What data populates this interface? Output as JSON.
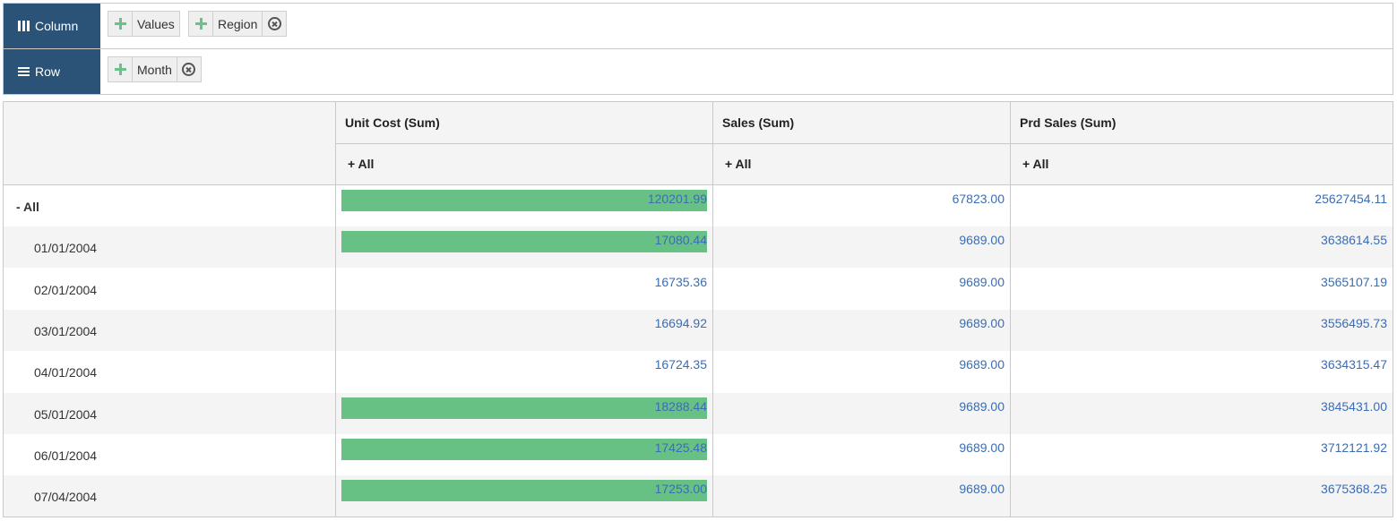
{
  "zones": {
    "column": {
      "label": "Column",
      "pills": [
        {
          "label": "Values",
          "removable": false
        },
        {
          "label": "Region",
          "removable": true
        }
      ]
    },
    "row": {
      "label": "Row",
      "pills": [
        {
          "label": "Month",
          "removable": true
        }
      ]
    }
  },
  "grid": {
    "columns": [
      {
        "header": "Unit Cost (Sum)",
        "sub": "+ All"
      },
      {
        "header": "Sales (Sum)",
        "sub": "+ All"
      },
      {
        "header": "Prd Sales (Sum)",
        "sub": "+ All"
      }
    ],
    "rows": [
      {
        "label": "- All",
        "bold": true,
        "values": [
          "120201.99",
          "67823.00",
          "25627454.11"
        ],
        "highlight": true
      },
      {
        "label": "01/01/2004",
        "bold": false,
        "values": [
          "17080.44",
          "9689.00",
          "3638614.55"
        ],
        "highlight": true
      },
      {
        "label": "02/01/2004",
        "bold": false,
        "values": [
          "16735.36",
          "9689.00",
          "3565107.19"
        ],
        "highlight": false
      },
      {
        "label": "03/01/2004",
        "bold": false,
        "values": [
          "16694.92",
          "9689.00",
          "3556495.73"
        ],
        "highlight": false
      },
      {
        "label": "04/01/2004",
        "bold": false,
        "values": [
          "16724.35",
          "9689.00",
          "3634315.47"
        ],
        "highlight": false
      },
      {
        "label": "05/01/2004",
        "bold": false,
        "values": [
          "18288.44",
          "9689.00",
          "3845431.00"
        ],
        "highlight": true
      },
      {
        "label": "06/01/2004",
        "bold": false,
        "values": [
          "17425.48",
          "9689.00",
          "3712121.92"
        ],
        "highlight": true
      },
      {
        "label": "07/04/2004",
        "bold": false,
        "values": [
          "17253.00",
          "9689.00",
          "3675368.25"
        ],
        "highlight": true
      }
    ]
  },
  "colors": {
    "zone_label_bg": "#2b5277",
    "highlight_bar": "#68c184",
    "value_text": "#3a6db5",
    "move_icon": "#6cc08a"
  }
}
